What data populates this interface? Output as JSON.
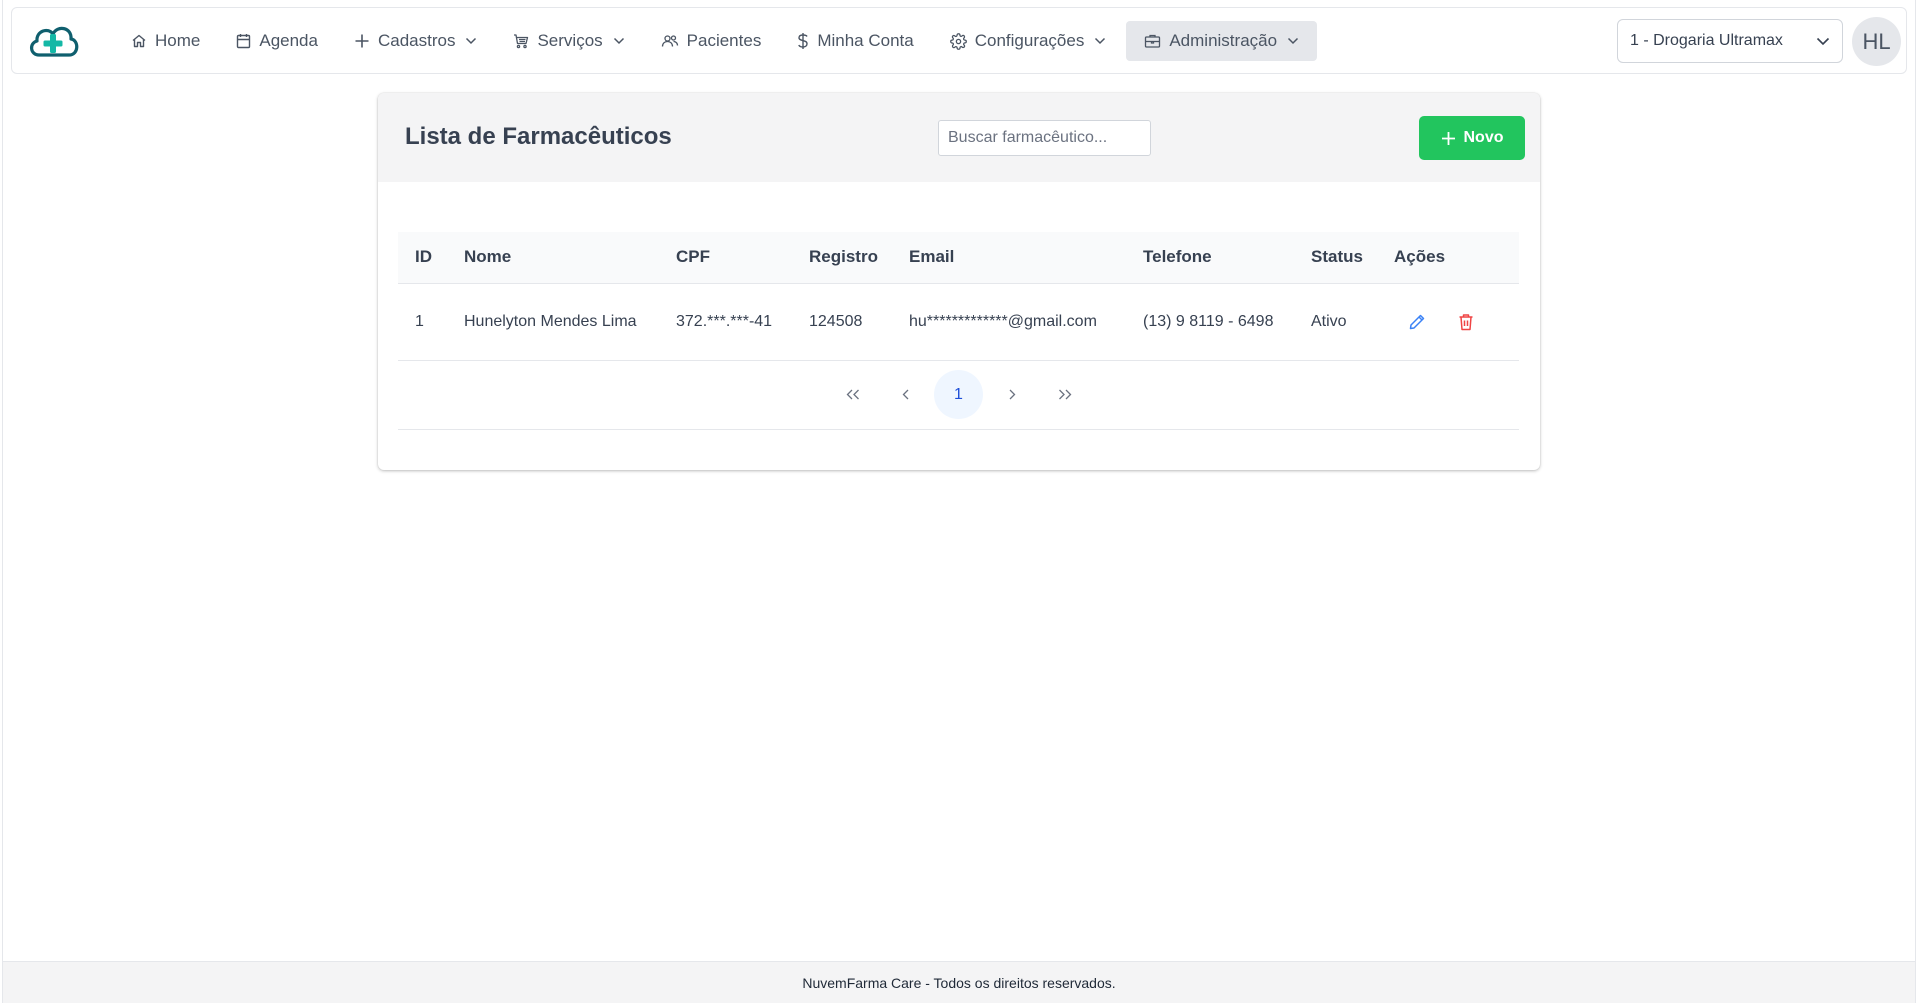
{
  "nav": {
    "items": [
      {
        "label": "Home",
        "icon": "home-icon"
      },
      {
        "label": "Agenda",
        "icon": "calendar-icon"
      },
      {
        "label": "Cadastros",
        "icon": "plus-icon"
      },
      {
        "label": "Serviços",
        "icon": "cart-icon"
      },
      {
        "label": "Pacientes",
        "icon": "users-icon"
      },
      {
        "label": "Minha Conta",
        "icon": "dollar-icon"
      },
      {
        "label": "Configurações",
        "icon": "gear-icon"
      },
      {
        "label": "Administração",
        "icon": "briefcase-icon"
      }
    ],
    "store_select": "1 - Drogaria Ultramax",
    "avatar_initials": "HL"
  },
  "page": {
    "title": "Lista de Farmacêuticos",
    "search_placeholder": "Buscar farmacêutico...",
    "new_button": "Novo"
  },
  "table": {
    "headers": [
      "ID",
      "Nome",
      "CPF",
      "Registro",
      "Email",
      "Telefone",
      "Status",
      "Ações"
    ],
    "rows": [
      {
        "id": "1",
        "nome": "Hunelyton Mendes Lima",
        "cpf": "372.***.***-41",
        "registro": "124508",
        "email": "hu*************@gmail.com",
        "telefone": "(13) 9 8119 - 6498",
        "status": "Ativo"
      }
    ]
  },
  "pagination": {
    "current_page": "1"
  },
  "footer": {
    "text": "NuvemFarma Care - Todos os direitos reservados."
  },
  "colors": {
    "brand_teal": "#0f5f6e",
    "accent_green": "#22c55e",
    "edit_blue": "#3b82f6",
    "delete_red": "#ef4444"
  }
}
